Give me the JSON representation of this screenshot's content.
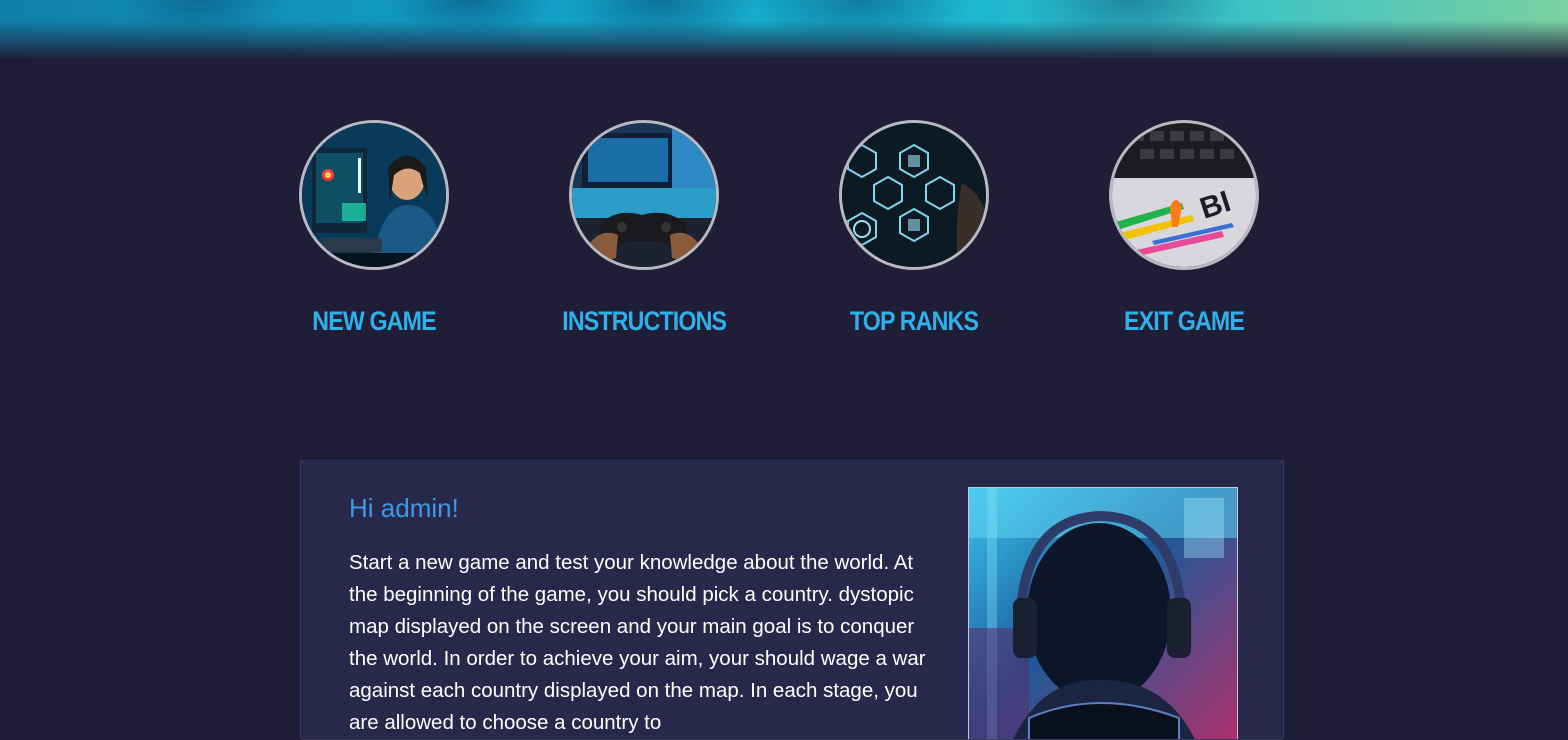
{
  "menu": [
    {
      "label": "NEW GAME",
      "icon": "gamer-girl-image"
    },
    {
      "label": "INSTRUCTIONS",
      "icon": "controller-image"
    },
    {
      "label": "TOP RANKS",
      "icon": "knowledge-hex-image"
    },
    {
      "label": "EXIT GAME",
      "icon": "keyboard-clips-image"
    }
  ],
  "welcome": {
    "greeting": "Hi admin!",
    "body": "Start a new game and test your knowledge about the world. At the beginning of the game, you should pick a country. dystopic map displayed on the screen and your main goal is to conquer the world. In order to achieve your aim, your should wage a war against each country displayed on the map. In each stage, you are allowed to choose a country to"
  },
  "colors": {
    "background": "#201e37",
    "accent": "#2fb0ea",
    "greeting": "#3d98e8",
    "card": "#28284a"
  }
}
